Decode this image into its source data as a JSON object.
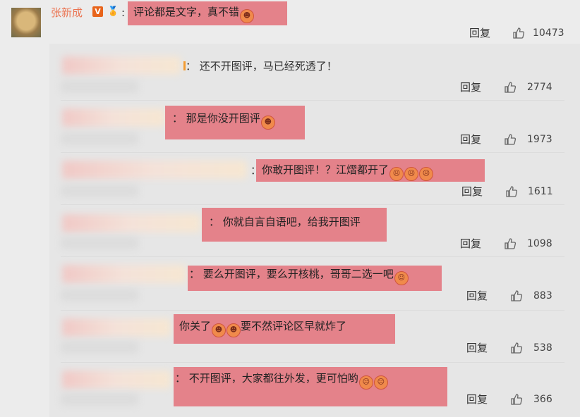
{
  "top_comment": {
    "author": "张新成",
    "verified_badge": "V",
    "medal_icon": "medal-icon",
    "colon": ":",
    "text": "评论都是文字，真不错",
    "reply_label": "回复",
    "likes": "10473"
  },
  "replies": [
    {
      "colon": "：",
      "text": "还不开图评，马已经死透了！",
      "emojis": [],
      "reply_label": "回复",
      "likes": "2774"
    },
    {
      "colon": "：",
      "text": "那是你没开图评",
      "emojis": [
        "😈"
      ],
      "reply_label": "回复",
      "likes": "1973"
    },
    {
      "colon": "：",
      "text": "你敢开图评！？江熠都开了",
      "emojis": [
        "😡",
        "😡",
        "😡"
      ],
      "reply_label": "回复",
      "likes": "1611"
    },
    {
      "colon": "：",
      "text": "你就自言自语吧，给我开图评",
      "emojis": [],
      "reply_label": "回复",
      "likes": "1098"
    },
    {
      "colon": "：",
      "text": "要么开图评，要么开核桃，哥哥二选一吧",
      "emojis": [
        "😜"
      ],
      "reply_label": "回复",
      "likes": "883"
    },
    {
      "colon": "",
      "text_before": "你关了",
      "emojis_mid": [
        "😈",
        "😈"
      ],
      "text": "要不然评论区早就炸了",
      "emojis": [],
      "reply_label": "回复",
      "likes": "538"
    },
    {
      "colon": "：",
      "text": "不开图评，大家都往外发，更可怕哟",
      "emojis": [
        "😡",
        "😡"
      ],
      "reply_label": "回复",
      "likes": "366"
    }
  ],
  "colors": {
    "author": "#eb7350",
    "highlight": "#e4828a",
    "background": "#ececec"
  }
}
